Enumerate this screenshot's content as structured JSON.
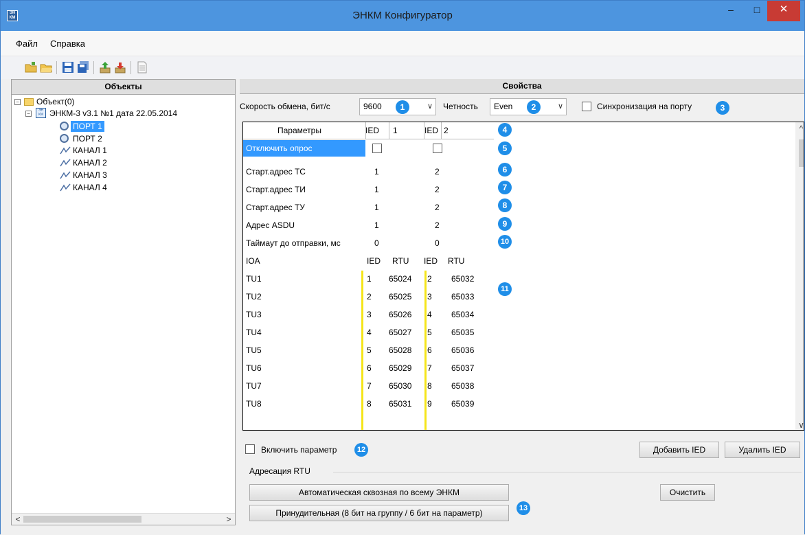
{
  "window": {
    "title": "ЭНКМ Конфигуратор",
    "icon_text": "ЭН КМ",
    "buttons": {
      "minimize": "–",
      "maximize": "□",
      "close": "✕"
    }
  },
  "menu": [
    "Файл",
    "Справка"
  ],
  "toolbar": [
    "new-folder-icon",
    "open-folder-icon",
    "save-icon",
    "save-all-icon",
    "upload-icon",
    "download-icon",
    "document-icon"
  ],
  "objects": {
    "header": "Объекты",
    "tree": {
      "root": "Объект(0)",
      "device": "ЭНКМ-3 v3.1 №1 дата 22.05.2014",
      "children": [
        "ПОРТ 1",
        "ПОРТ 2",
        "КАНАЛ 1",
        "КАНАЛ 2",
        "КАНАЛ 3",
        "КАНАЛ 4"
      ]
    }
  },
  "properties": {
    "header": "Свойства",
    "speed_label": "Скорость обмена, бит/с",
    "speed_value": "9600",
    "parity_label": "Четность",
    "parity_value": "Even",
    "sync_label": "Синхронизация на порту",
    "badges": [
      "1",
      "2",
      "3",
      "4",
      "5",
      "6",
      "7",
      "8",
      "9",
      "10",
      "11",
      "12",
      "13"
    ]
  },
  "grid": {
    "header": {
      "param": "Параметры",
      "ied1": "IED",
      "ied1_num": "1",
      "ied2": "IED",
      "ied2_num": "2"
    },
    "params": [
      {
        "name": "Отключить опрос",
        "v1": "",
        "v2": ""
      },
      {
        "name": "Старт.адрес ТС",
        "v1": "1",
        "v2": "2"
      },
      {
        "name": "Старт.адрес ТИ",
        "v1": "1",
        "v2": "2"
      },
      {
        "name": "Старт.адрес ТУ",
        "v1": "1",
        "v2": "2"
      },
      {
        "name": "Адрес ASDU",
        "v1": "1",
        "v2": "2"
      },
      {
        "name": "Таймаут до отправки, мс",
        "v1": "0",
        "v2": "0"
      }
    ],
    "ioa_header": {
      "name": "IOA",
      "c1": "IED",
      "c2": "RTU",
      "c3": "IED",
      "c4": "RTU"
    },
    "ioa_rows": [
      [
        "TU1",
        "1",
        "65024",
        "2",
        "65032"
      ],
      [
        "TU2",
        "2",
        "65025",
        "3",
        "65033"
      ],
      [
        "TU3",
        "3",
        "65026",
        "4",
        "65034"
      ],
      [
        "TU4",
        "4",
        "65027",
        "5",
        "65035"
      ],
      [
        "TU5",
        "5",
        "65028",
        "6",
        "65036"
      ],
      [
        "TU6",
        "6",
        "65029",
        "7",
        "65037"
      ],
      [
        "TU7",
        "7",
        "65030",
        "8",
        "65038"
      ],
      [
        "TU8",
        "8",
        "65031",
        "9",
        "65039"
      ]
    ]
  },
  "bottom": {
    "enable_param": "Включить параметр",
    "add_ied": "Добавить IED",
    "remove_ied": "Удалить IED",
    "group_title": "Адресация RTU",
    "auto_button": "Автоматическая сквозная по всему ЭНКМ",
    "force_button": "Принудительная (8 бит на группу / 6 бит на параметр)",
    "clear_button": "Очистить"
  }
}
